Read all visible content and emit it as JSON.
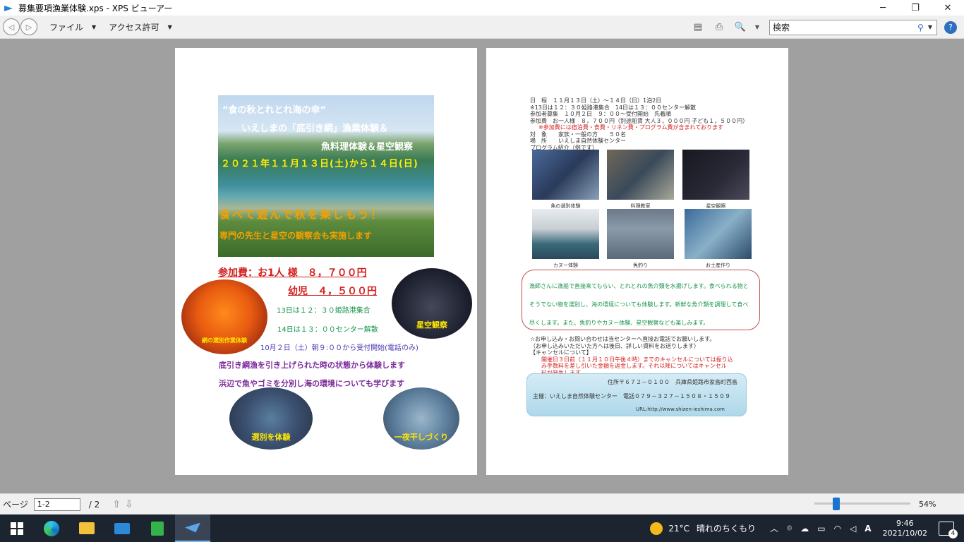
{
  "window": {
    "title": "募集要項漁業体験.xps - XPS ビューアー",
    "minimize": "─",
    "maximize": "❐",
    "close": "✕"
  },
  "menubar": {
    "back": "◁",
    "forward": "▷",
    "file": "ファイル",
    "access": "アクセス許可",
    "search_label": "検索"
  },
  "page1": {
    "headline1": "“食の秋とれとれ海の幸“",
    "headline2": "いえしまの「底引き網」漁業体験＆",
    "headline3": "魚料理体験＆星空観察",
    "date": "２０２１年１１月１３日(土)から１４日(日)",
    "slogan": "食べて遊んで秋を楽しもう！",
    "subslogan": "専門の先生と星空の観察会も実施します",
    "fee_adult": "参加費：お1人 様　８，７００円",
    "fee_child": "幼児　４，５００円",
    "gather1": "13日は１２：３０姫路港集合",
    "gather2": "14日は１３：００センター解散",
    "reception": "10月２日（土）朝９:００から受付開始(電話のみ)",
    "desc1": "底引き網漁を引き上げられた時の状態から体験します",
    "desc2": "浜辺で魚やゴミを分別し海の環境についても学びます",
    "crab_label": "網の選別作業体験",
    "star_label": "星空観察",
    "fish_label": "選別を体験",
    "dry_label": "一夜干しづくり"
  },
  "page2": {
    "info_lines": [
      "日　程　１１月１３日（土）～１４日（日）1泊2日",
      "※13日は１２：３０姫路港集合　14日は１３：００センター解散",
      "参加者募集　１０月２日　９：００～受付開始　先着順",
      "参加費　お一人様　８，７００円（別途船賃 大人３，０００円 子ども１，５００円）"
    ],
    "info_red": "※参加費には宿泊費・食費・リネン費・プログラム費が含まれております",
    "info_lines2": [
      "対　象　　家族・一般の方　　５０名",
      "場　所　　いえしま自然体験センター",
      "プログラム紹介（例です）"
    ],
    "photos": [
      {
        "cap": "魚の選別体験"
      },
      {
        "cap": "料理教室"
      },
      {
        "cap": "星空観察"
      },
      {
        "cap": "カヌー体験"
      },
      {
        "cap": "魚釣り"
      },
      {
        "cap": "お土産作り"
      }
    ],
    "box_text": "漁師さんに漁船で直接来てもらい、とれとれの魚介類を水揚げします。食べられる物とそうでない物を選別し、海の環境についても体験します。新鮮な魚介類を調理して食べ尽くします。また、魚釣りやカヌー体験、星空観察なども楽しみます。",
    "apply1": "☆お申し込み・お問い合わせは当センターへ直接お電話でお願いします。",
    "apply2": "（お申し込みいただいた方へは後日、詳しい資料をお送りします）",
    "apply3": "【キャンセルについて】",
    "cancel_red1": "開催日３日前（１１月１０日午後４時）までのキャンセルについては振り込",
    "cancel_red2": "み手数料を差し引いた金額を返金します。それ以降についてはキャンセル",
    "cancel_red3": "料が発生します。",
    "address": "住所〒６７２－０１００　兵庫県姫路市家島町西島",
    "host": "主催：いえしま自然体験センター　電話０７９－３２７－１５０８・１５０９",
    "url": "URL:http://www.shizen-ieshima.com"
  },
  "status": {
    "page_label": "ページ",
    "page_value": "1-2",
    "total": "/ 2",
    "zoom": "54%"
  },
  "taskbar": {
    "temp": "21°C",
    "weather": "晴れのちくもり",
    "time": "9:46",
    "date": "2021/10/02",
    "notif_count": "4"
  }
}
